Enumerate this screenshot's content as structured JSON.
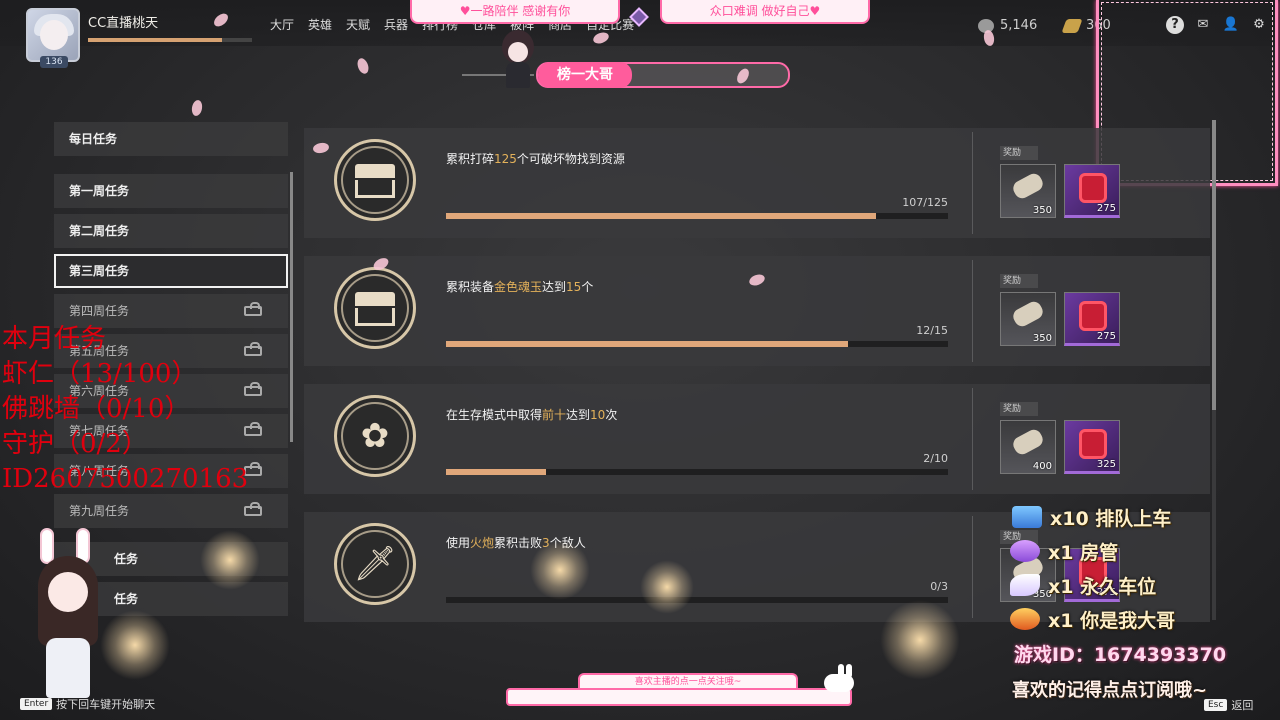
{
  "player": {
    "name": "CC直播桃天",
    "level": "136",
    "xp_fraction": 0.82
  },
  "nav": [
    "大厅",
    "英雄",
    "天赋",
    "兵器",
    "排行榜",
    "仓库",
    "被阵",
    "商店",
    "自定比赛"
  ],
  "stream_banners": {
    "left": "♥一路陪伴 感谢有你",
    "right": "众口难调 做好自己♥"
  },
  "currency": {
    "coins": "5,146",
    "tickets": "360"
  },
  "page_title": "榜一大哥",
  "sidebar": {
    "daily": "每日任务",
    "weeks": [
      {
        "label": "第一周任务",
        "locked": false
      },
      {
        "label": "第二周任务",
        "locked": false
      },
      {
        "label": "第三周任务",
        "locked": false,
        "active": true
      },
      {
        "label": "第四周任务",
        "locked": true
      },
      {
        "label": "第五周任务",
        "locked": true
      },
      {
        "label": "第六周任务",
        "locked": true
      },
      {
        "label": "第七周任务",
        "locked": true
      },
      {
        "label": "第八周任务",
        "locked": true
      },
      {
        "label": "第九周任务",
        "locked": true
      }
    ],
    "extra": [
      "任务",
      "任务"
    ]
  },
  "tasks": [
    {
      "desc_pre": "累积打碎",
      "hl1": "125",
      "desc_mid": "个可破坏物找到资源",
      "hl2": "",
      "desc_post": "",
      "progress": 0.856,
      "count": "107/125",
      "icon": "chest-icon",
      "reward_label": "奖励",
      "reward_scroll_qty": "350",
      "reward_gem_qty": "275"
    },
    {
      "desc_pre": "累积装备",
      "hl1": "金色魂玉",
      "desc_mid": "达到",
      "hl2": "15",
      "desc_post": "个",
      "progress": 0.8,
      "count": "12/15",
      "icon": "chest-icon",
      "reward_label": "奖励",
      "reward_scroll_qty": "350",
      "reward_gem_qty": "275"
    },
    {
      "desc_pre": "在生存模式中取得",
      "hl1": "前十",
      "desc_mid": "达到",
      "hl2": "10",
      "desc_post": "次",
      "progress": 0.2,
      "count": "2/10",
      "icon": "flower-icon",
      "reward_label": "奖励",
      "reward_scroll_qty": "400",
      "reward_gem_qty": "325"
    },
    {
      "desc_pre": "使用",
      "hl1": "火炮",
      "desc_mid": "累积击败",
      "hl2": "3",
      "desc_post": "个敌人",
      "progress": 0.0,
      "count": "0/3",
      "icon": "sword-icon",
      "reward_label": "奖励",
      "reward_scroll_qty": "350",
      "reward_gem_qty": "275"
    }
  ],
  "overlay_text": [
    "本月任务",
    "虾仁（13/100）",
    "佛跳墙（0/10）",
    "守护（0/2）",
    "ID2607500270163"
  ],
  "gifts": [
    {
      "text": "x10 排队上车",
      "icon": "ticket-gift-icon"
    },
    {
      "text": "x1 房管",
      "icon": "gem-gift-icon"
    },
    {
      "text": "x1 永久车位",
      "icon": "wing-gift-icon"
    },
    {
      "text": "x1 你是我大哥",
      "icon": "crown-gift-icon"
    }
  ],
  "game_id": "游戏ID：1674393370",
  "subscribe_text": "喜欢的记得点点订阅哦~",
  "chat": {
    "label": "喜欢主播的点一点关注哦~",
    "enter_key": "Enter",
    "enter_hint": "按下回车键开始聊天",
    "esc_key": "Esc",
    "esc_hint": "返回"
  },
  "colors": {
    "accent_pink": "#ff6aa8",
    "progress": "#e0a77a",
    "highlight": "#e3b15a",
    "overlay_red": "#e0000e"
  }
}
